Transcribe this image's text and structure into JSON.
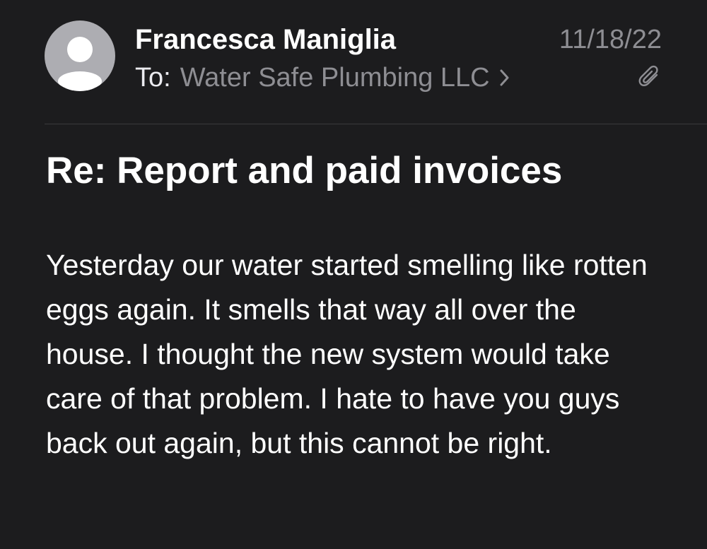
{
  "message": {
    "sender": {
      "name": "Francesca Maniglia",
      "avatar_icon": "person-placeholder-icon"
    },
    "date": "11/18/22",
    "recipient": {
      "label": "To:",
      "name": "Water Safe Plumbing LLC",
      "chevron_icon": "chevron-right-icon"
    },
    "attachment_icon": "paperclip-icon",
    "subject": "Re: Report and paid invoices",
    "body": "Yesterday our water started smelling like rotten eggs again. It smells that way all over the house. I thought the new system would take care of that problem. I hate to have you guys back out again, but this cannot be right."
  },
  "colors": {
    "background": "#1c1c1e",
    "primary_text": "#ffffff",
    "secondary_text": "#8e8e93",
    "avatar_bg": "#adadb2",
    "divider": "#3a3a3c"
  }
}
